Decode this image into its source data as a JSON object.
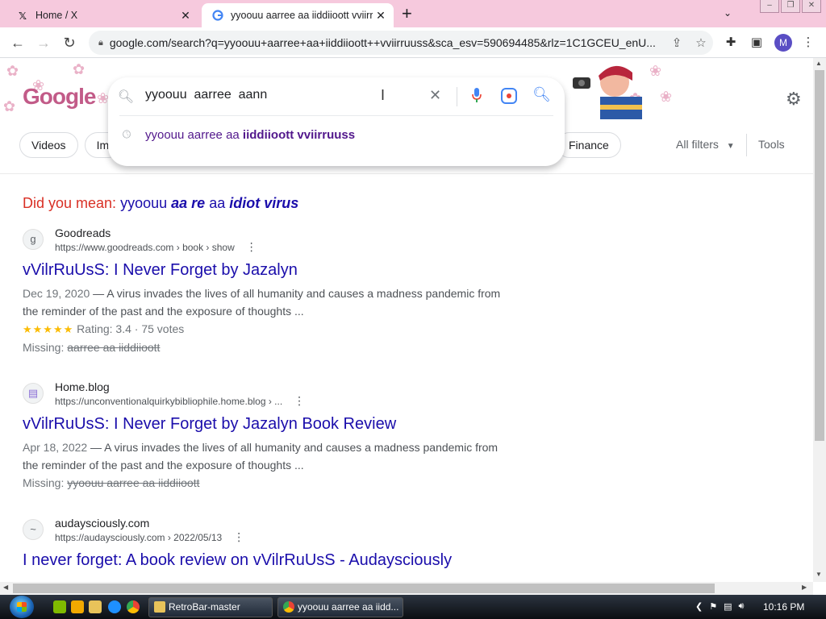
{
  "browser": {
    "tabs": [
      {
        "title": "Home / X",
        "icon": "x-logo-icon",
        "active": false
      },
      {
        "title": "yyoouu aarree aa iiddiioott vviirruuss",
        "icon": "google-g-icon",
        "active": true
      }
    ],
    "address": "google.com/search?q=yyoouu+aarree+aa+iiddiioott++vviirruuss&sca_esv=590694485&rlz=1C1GCEU_enU...",
    "profile_initial": "M"
  },
  "google": {
    "logo_text": "Google",
    "chips": [
      "Videos",
      "Im"
    ],
    "chip_finance": "Finance",
    "all_filters": "All filters",
    "tools": "Tools"
  },
  "search_box": {
    "query": "yyoouu  aarree  aann",
    "suggestion_prefix": "yyoouu aarree aa ",
    "suggestion_bold": "iiddiioott vviirruuss"
  },
  "did_you_mean": {
    "label": "Did you mean:",
    "w1": "yyoouu",
    "w2": "aa re",
    "w3": "aa",
    "w4": "idiot virus"
  },
  "results": [
    {
      "site": "Goodreads",
      "url": "https://www.goodreads.com › book › show",
      "icon": "g",
      "title": "vVilrRuUsS: I Never Forget by Jazalyn",
      "date": "Dec 19, 2020",
      "snippet": " — A virus invades the lives of all humanity and causes a madness pandemic from the reminder of the past and the exposure of thoughts ...",
      "stars": "★★★★★",
      "rating": "Rating: 3.4 · 75 votes",
      "missing_label": "Missing:",
      "missing": "aarree aa iiddiioott"
    },
    {
      "site": "Home.blog",
      "url": "https://unconventionalquirkybibliophile.home.blog › ...",
      "icon": "▤",
      "title": "vVilrRuUsS: I Never Forget by Jazalyn Book Review",
      "date": "Apr 18, 2022",
      "snippet": " — A virus invades the lives of all humanity and causes a madness pandemic from the reminder of the past and the exposure of thoughts ...",
      "missing_label": "Missing:",
      "missing": "yyoouu aarree aa iiddiioott"
    },
    {
      "site": "audaysciously.com",
      "url": "https://audaysciously.com › 2022/05/13",
      "icon": "~",
      "title": "I never forget: A book review on vVilrRuUsS - Audaysciously"
    }
  ],
  "taskbar": {
    "btn1": "RetroBar-master",
    "btn2": "yyoouu aarree aa iidd...",
    "clock": "10:16 PM"
  },
  "colors": {
    "tabbar": "#f6c9dd",
    "link": "#1a0dab",
    "visited": "#52188c",
    "dym_label": "#d93025"
  }
}
